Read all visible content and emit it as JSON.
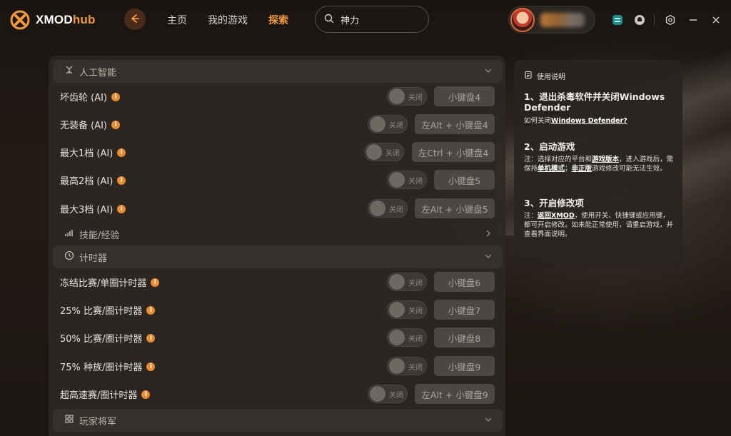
{
  "app": {
    "logo_main": "XMOD",
    "logo_accent": "hub"
  },
  "nav": {
    "home": "主页",
    "my_games": "我的游戏",
    "explore": "探索"
  },
  "search": {
    "value": "神力"
  },
  "sections": {
    "ai": "人工智能",
    "skills": "技能/经验",
    "timer": "计时器",
    "player_general": "玩家将军"
  },
  "toggle_off": "关闭",
  "ai_rows": [
    {
      "label": "坏齿轮 (AI)",
      "key": "小键盘4"
    },
    {
      "label": "无装备 (AI)",
      "key": "左Alt + 小键盘4"
    },
    {
      "label": "最大1档 (AI)",
      "key": "左Ctrl + 小键盘4"
    },
    {
      "label": "最高2档 (AI)",
      "key": "小键盘5"
    },
    {
      "label": "最大3档 (AI)",
      "key": "左Alt + 小键盘5"
    }
  ],
  "timer_rows": [
    {
      "label": "冻结比赛/单圈计时器",
      "key": "小键盘6"
    },
    {
      "label": "25% 比赛/圈计时器",
      "key": "小键盘7"
    },
    {
      "label": "50% 比赛/圈计时器",
      "key": "小键盘8"
    },
    {
      "label": "75% 种族/圈计时器",
      "key": "小键盘9"
    },
    {
      "label": "超高速赛/圈计时器",
      "key": "左Alt + 小键盘9"
    }
  ],
  "help": {
    "title": "使用说明",
    "step1_title": "1、退出杀毒软件并关闭Windows Defender",
    "step1_prefix": "如何关闭",
    "step1_link": "Windows Defender?",
    "step2_title": "2、启动游戏",
    "step2_a": "注：选择对应的平台和",
    "step2_link1": "游戏版本",
    "step2_b": "，进入游戏后，需保持",
    "step2_link2": "单机模式",
    "step2_c": "；",
    "step2_link3": "非正版",
    "step2_d": "游戏修改可能无法生效。",
    "step3_title": "3、开启修改项",
    "step3_a": "注：",
    "step3_link": "返回XMOD",
    "step3_b": "，使用开关、快捷键或应用键，都可开启修改。如未能正常使用，请重启游戏，并查看界面说明。"
  },
  "colors": {
    "accent": "#f29a38",
    "info": "#f08a2e",
    "panel": "#2c2824"
  }
}
